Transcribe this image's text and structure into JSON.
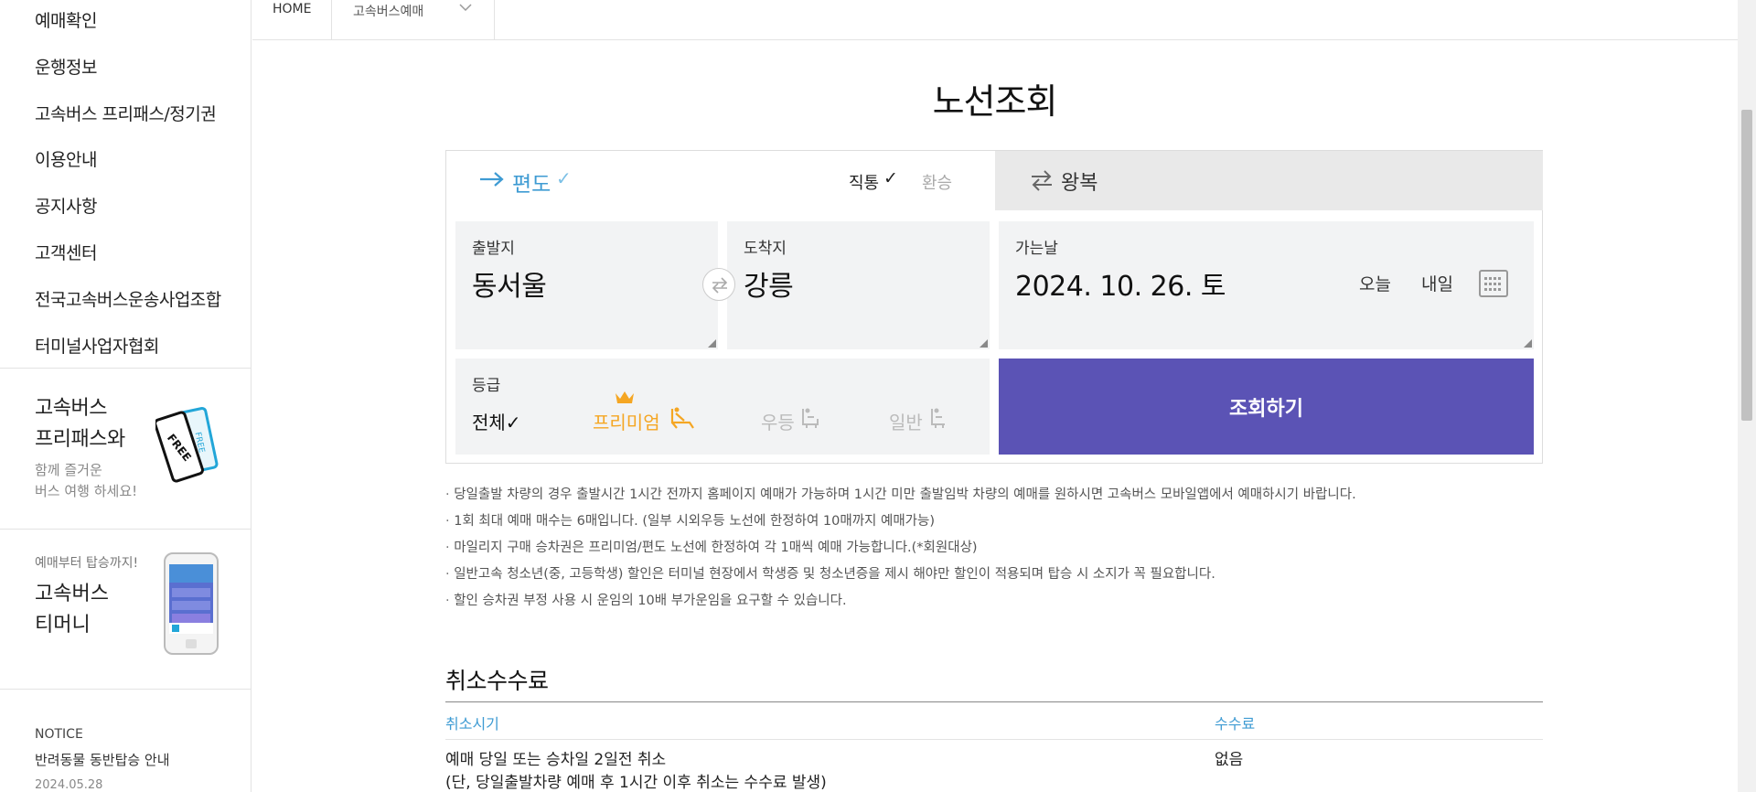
{
  "sidebar": {
    "menu": [
      "예매확인",
      "운행정보",
      "고속버스 프리패스/정기권",
      "이용안내",
      "공지사항",
      "고객센터",
      "전국고속버스운송사업조합",
      "터미널사업자협회"
    ],
    "promo_freepass": {
      "title_line1": "고속버스",
      "title_line2": "프리패스와",
      "sub_line1": "함께 즐거운",
      "sub_line2": "버스 여행 하세요!"
    },
    "promo_tmoney": {
      "small": "예매부터 탑승까지!",
      "title_line1": "고속버스",
      "title_line2": "티머니"
    },
    "notice": {
      "label": "NOTICE",
      "title": "반려동물 동반탑승 안내",
      "date": "2024.05.28"
    }
  },
  "breadcrumb": {
    "home": "HOME",
    "current": "고속버스예매"
  },
  "main": {
    "title": "노선조회",
    "trip_type": {
      "oneway": "편도",
      "oneway_check": "✓",
      "direct": "직통",
      "direct_check": "✓",
      "transfer": "환승",
      "round": "왕복"
    },
    "departure": {
      "label": "출발지",
      "value": "동서울"
    },
    "arrival": {
      "label": "도착지",
      "value": "강릉"
    },
    "date": {
      "label": "가는날",
      "value": "2024. 10. 26. 토",
      "today": "오늘",
      "tomorrow": "내일"
    },
    "grade": {
      "label": "등급",
      "all": "전체✓",
      "premium": "프리미엄",
      "first": "우등",
      "normal": "일반"
    },
    "search_button": "조회하기",
    "notes": [
      "당일출발 차량의 경우 출발시간 1시간 전까지 홈페이지 예매가 가능하며 1시간 미만 출발임박 차량의 예매를 원하시면 고속버스 모바일앱에서 예매하시기 바랍니다.",
      "1회 최대 예매 매수는 6매입니다. (일부 시외우등 노선에 한정하여 10매까지 예매가능)",
      "마일리지 구매 승차권은 프리미엄/편도 노선에 한정하여 각 1매씩 예매 가능합니다.(*회원대상)",
      "일반고속 청소년(중, 고등학생) 할인은 터미널 현장에서 학생증 및 청소년증을 제시 해야만 할인이 적용되며 탑승 시 소지가 꼭 필요합니다.",
      "할인 승차권 부정 사용 시 운임의 10배 부가운임을 요구할 수 있습니다."
    ],
    "fee": {
      "title": "취소수수료",
      "col_time": "취소시기",
      "col_fee": "수수료",
      "rows": [
        {
          "time_line1": "예매 당일 또는 승차일 2일전 취소",
          "time_line2": "(단, 당일출발차량 예매 후 1시간 이후 취소는 수수료 발생)",
          "fee": "없음"
        }
      ]
    }
  },
  "colors": {
    "accent_blue": "#3e9bd3",
    "search_button": "#5b53b5",
    "premium": "#f5a623"
  }
}
